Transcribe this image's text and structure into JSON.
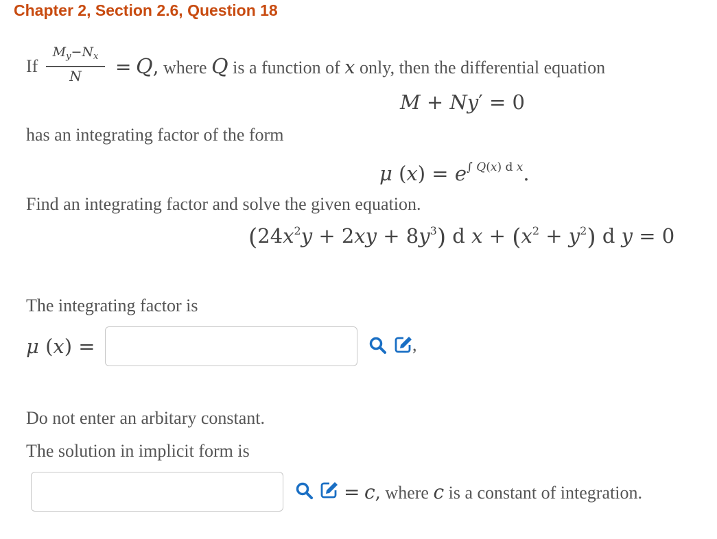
{
  "header": {
    "title": "Chapter 2, Section 2.6, Question 18"
  },
  "intro": {
    "if_word": "If",
    "fraction_numerator": "My−Nx",
    "fraction_numerator_parts": [
      "M",
      "y",
      "−",
      "N",
      "x"
    ],
    "fraction_denominator": "N",
    "equals_Q": "= Q,",
    "where_text": "where",
    "Q_var": "Q",
    "function_text": "is a function of",
    "x_var": "x",
    "only_text": "only, then the differential equation",
    "equation": "M + Ny′ = 0",
    "has_text": "has an integrating factor of the form",
    "mu_form": "μ (x) = e",
    "mu_exponent": "∫ Q(x) d x",
    "period": "."
  },
  "problem": {
    "instruction": "Find an integrating factor and solve the given equation.",
    "equation_part1": "(24x²y + 2xy + 8y³) d x + (x² + y²) d y = 0"
  },
  "question1": {
    "label": "The integrating factor is",
    "lhs": "μ (x) =",
    "input_value": "",
    "input_placeholder": "",
    "trailing": ","
  },
  "note": {
    "text": "Do not enter an arbitary constant."
  },
  "question2": {
    "label": "The solution in implicit form is",
    "input_value": "",
    "input_placeholder": "",
    "rhs_equals": "= c,",
    "where_text": "where",
    "c_var": "c",
    "rest_text": "is a constant of integration."
  },
  "icons": {
    "search": "magnifier-icon",
    "edit": "pencil-square-icon",
    "color": "#1a6fc4"
  }
}
